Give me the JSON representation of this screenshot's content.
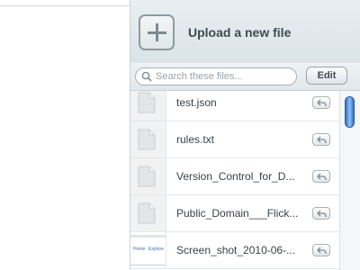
{
  "panel": {
    "upload_label": "Upload a new file",
    "search_placeholder": "Search these files...",
    "edit_label": "Edit"
  },
  "files": [
    {
      "name": "test.json",
      "thumb": "document-icon"
    },
    {
      "name": "rules.txt",
      "thumb": "document-icon"
    },
    {
      "name": "Version_Control_for_D...",
      "thumb": "document-icon"
    },
    {
      "name": "Public_Domain___Flick...",
      "thumb": "document-icon"
    },
    {
      "name": "Screen_shot_2010-06-...",
      "thumb": "screenshot-thumbnail",
      "thumb_text": [
        "Home",
        "Explore"
      ]
    }
  ],
  "colors": {
    "accent": "#2f6fc7",
    "header_bg": "#e1e8ec"
  }
}
